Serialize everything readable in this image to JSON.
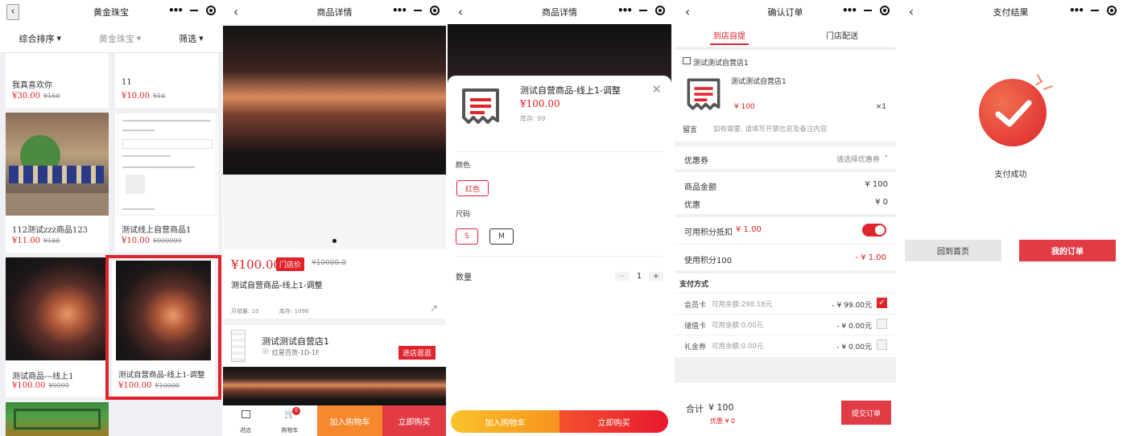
{
  "p1": {
    "title": "黄金珠宝",
    "sort": [
      "综合排序",
      "黄金珠宝",
      "筛选"
    ],
    "cards": [
      {
        "title": "我真喜欢你",
        "price": "¥30.00",
        "old": "¥150"
      },
      {
        "title": "11",
        "price": "¥10.00",
        "old": "¥10"
      },
      {
        "title": "112测试zzz商品123",
        "price": "¥11.00",
        "old": "¥188"
      },
      {
        "title": "测试线上自营商品1",
        "price": "¥10.00",
        "old": "¥999999"
      },
      {
        "title": "测试商品---线上1",
        "price": "¥100.00",
        "old": "¥9999"
      },
      {
        "title": "测试自营商品-线上1-调整",
        "price": "¥100.00",
        "old": "¥10000"
      }
    ]
  },
  "p2": {
    "title": "商品详情",
    "price": "¥100.00",
    "badge": "门店价",
    "old": "¥10000.0",
    "name": "测试自营商品-线上1-调整",
    "sales": "月销量: 10",
    "stock": "库存: 1098",
    "store": "测试测试自营店1",
    "location": "红星百货-1D-1F",
    "visit": "进店逛逛",
    "nav": [
      "进店",
      "购物车"
    ],
    "cart_count": "0",
    "add_cart": "加入购物车",
    "buy": "立即购买"
  },
  "p3": {
    "title": "商品详情",
    "name": "测试自营商品-线上1-调整",
    "price": "¥100.00",
    "stock": "库存: 99",
    "color_label": "颜色",
    "color": "红色",
    "size_label": "尺码",
    "sizes": [
      "S",
      "M"
    ],
    "qty_label": "数量",
    "qty": "1",
    "add_cart": "加入购物车",
    "buy": "立即购买"
  },
  "p4": {
    "title": "确认订单",
    "tabs": [
      "到店自提",
      "门店配送"
    ],
    "store": "测试测试自营店1",
    "item": "测试测试自营店1",
    "item_price": "¥ 100",
    "item_qty": "×1",
    "msg_label": "留言",
    "msg_ph": "如有需要, 请填写开票信息及备注内容",
    "coupon_label": "优惠券",
    "coupon_value": "请选择优惠券",
    "amount_label": "商品金额",
    "amount": "¥ 100",
    "discount_label": "优惠",
    "discount": "¥ 0",
    "points_label": "可用积分抵扣",
    "points_value": "¥ 1.00",
    "use_points": "使用积分100",
    "use_points_value": "- ¥ 1.00",
    "pay_title": "支付方式",
    "pays": [
      {
        "name": "会员卡",
        "balance": "可用余额:298.18元",
        "amt": "- ¥ 99.00元",
        "checked": true
      },
      {
        "name": "储值卡",
        "balance": "可用余额:0.00元",
        "amt": "- ¥ 0.00元",
        "checked": false
      },
      {
        "name": "礼金券",
        "balance": "可用余额:0.00元",
        "amt": "- ¥ 0.00元",
        "checked": false
      }
    ],
    "total_label": "合计",
    "total": "¥ 100",
    "saved": "优惠 ¥ 0",
    "submit": "提交订单"
  },
  "p5": {
    "title": "支付结果",
    "status": "支付成功",
    "home": "回到首页",
    "orders": "我的订单"
  }
}
